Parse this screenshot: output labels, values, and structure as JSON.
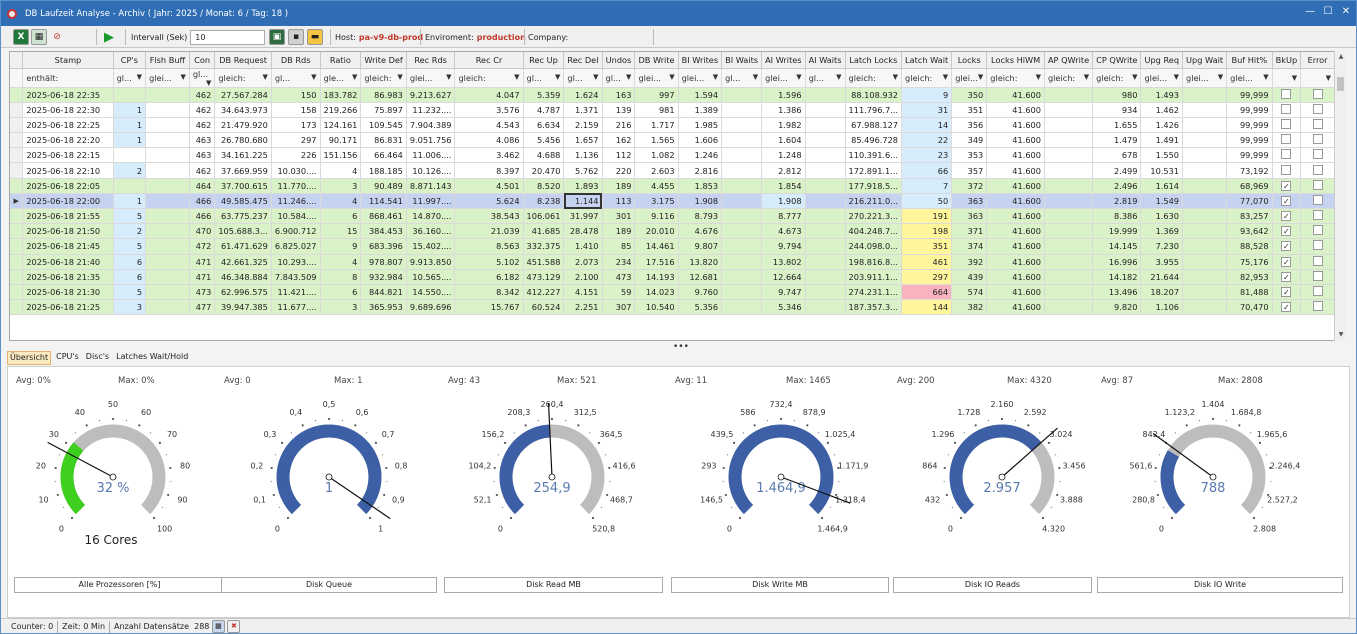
{
  "title": "DB Laufzeit Analyse - Archiv ( Jahr: 2025 / Monat: 6  / Tag: 18 )",
  "toolbar": {
    "interval_label": "Intervall (Sek)",
    "interval_value": "10",
    "host_label": "Host:",
    "host_value": "pa-v9-db-prod",
    "env_label": "Enviroment:",
    "env_value": "production",
    "company_label": "Company:",
    "company_value": ""
  },
  "grid": {
    "columns": [
      "Stamp",
      "CP's",
      "Flsh Buff",
      "Con",
      "DB Request",
      "DB Rds",
      "Ratio",
      "Write Def",
      "Rec Rds",
      "Rec Cr",
      "Rec Up",
      "Rec Del",
      "Undos",
      "DB Write",
      "BI Writes",
      "BI Waits",
      "AI Writes",
      "AI Waits",
      "Latch Locks",
      "Latch Wait",
      "Locks",
      "Locks HiWM",
      "AP QWrite",
      "CP QWrite",
      "Upg Req",
      "Upg Wait",
      "Buf Hit%",
      "BkUp",
      "Error"
    ],
    "filters": [
      "enthält:",
      "gl...",
      "glei...",
      "gl...",
      "gleich:",
      "gl...",
      "gle...",
      "gleich:",
      "glei...",
      "gleich:",
      "gl...",
      "gl...",
      "gl...",
      "glei...",
      "glei...",
      "gl...",
      "glei...",
      "gl...",
      "gleich:",
      "gleich:",
      "glei...",
      "gleich:",
      "gleich:",
      "gleich:",
      "glei...",
      "glei...",
      "glei...",
      "",
      ""
    ],
    "rows": [
      {
        "s": "green",
        "cells": [
          "2025-06-18 22:35",
          "",
          "",
          "462",
          "27.567.284",
          "150",
          "183.782",
          "86.983",
          "9.213.627",
          "4.047",
          "5.359",
          "1.624",
          "163",
          "997",
          "1.594",
          "",
          "1.596",
          "",
          "88.108.932",
          "9",
          "350",
          "41.600",
          "",
          "980",
          "1.493",
          "",
          "99,999",
          "",
          ""
        ]
      },
      {
        "s": "",
        "cells": [
          "2025-06-18 22:30",
          "1",
          "",
          "462",
          "34.643.973",
          "158",
          "219.266",
          "75.897",
          "11.232....",
          "3.576",
          "4.787",
          "1.371",
          "139",
          "981",
          "1.389",
          "",
          "1.386",
          "",
          "111.796.7...",
          "31",
          "351",
          "41.600",
          "",
          "934",
          "1.462",
          "",
          "99,999",
          "",
          ""
        ]
      },
      {
        "s": "",
        "cells": [
          "2025-06-18 22:25",
          "1",
          "",
          "462",
          "21.479.920",
          "173",
          "124.161",
          "109.545",
          "7.904.389",
          "4.543",
          "6.634",
          "2.159",
          "216",
          "1.717",
          "1.985",
          "",
          "1.982",
          "",
          "67.988.127",
          "14",
          "356",
          "41.600",
          "",
          "1.655",
          "1.426",
          "",
          "99,999",
          "",
          ""
        ]
      },
      {
        "s": "",
        "cells": [
          "2025-06-18 22:20",
          "1",
          "",
          "463",
          "26.780.680",
          "297",
          "90.171",
          "86.831",
          "9.051.756",
          "4.086",
          "5.456",
          "1.657",
          "162",
          "1.565",
          "1.606",
          "",
          "1.604",
          "",
          "85.496.728",
          "22",
          "349",
          "41.600",
          "",
          "1.479",
          "1.491",
          "",
          "99,999",
          "",
          ""
        ]
      },
      {
        "s": "",
        "cells": [
          "2025-06-18 22:15",
          "",
          "",
          "463",
          "34.161.225",
          "226",
          "151.156",
          "66.464",
          "11.006....",
          "3.462",
          "4.688",
          "1.136",
          "112",
          "1.082",
          "1.246",
          "",
          "1.248",
          "",
          "110.391.6...",
          "23",
          "353",
          "41.600",
          "",
          "678",
          "1.550",
          "",
          "99,999",
          "",
          ""
        ]
      },
      {
        "s": "",
        "cells": [
          "2025-06-18 22:10",
          "2",
          "",
          "462",
          "37.669.959",
          "10.030....",
          "4",
          "188.185",
          "10.126....",
          "8.397",
          "20.470",
          "5.762",
          "220",
          "2.603",
          "2.816",
          "",
          "2.812",
          "",
          "172.891.1...",
          "66",
          "357",
          "41.600",
          "",
          "2.499",
          "10.531",
          "",
          "73,192",
          "",
          ""
        ]
      },
      {
        "s": "green",
        "cells": [
          "2025-06-18 22:05",
          "",
          "",
          "464",
          "37.700.615",
          "11.770....",
          "3",
          "90.489",
          "8.871.143",
          "4.501",
          "8.520",
          "1.893",
          "189",
          "4.455",
          "1.853",
          "",
          "1.854",
          "",
          "177.918.5...",
          "7",
          "372",
          "41.600",
          "",
          "2.496",
          "1.614",
          "",
          "68,969",
          "✓",
          ""
        ]
      },
      {
        "s": "blue",
        "cells": [
          "2025-06-18 22:00",
          "1",
          "",
          "466",
          "49.585.475",
          "11.246....",
          "4",
          "114.541",
          "11.997....",
          "5.624",
          "8.238",
          "1.144",
          "113",
          "3.175",
          "1.908",
          "",
          "1.908",
          "",
          "216.211.0...",
          "50",
          "363",
          "41.600",
          "",
          "2.819",
          "1.549",
          "",
          "77,070",
          "✓",
          ""
        ]
      },
      {
        "s": "green",
        "cells": [
          "2025-06-18 21:55",
          "5",
          "",
          "466",
          "63.775.237",
          "10.584....",
          "6",
          "868.461",
          "14.870....",
          "38.543",
          "106.061",
          "31.997",
          "301",
          "9.116",
          "8.793",
          "",
          "8.777",
          "",
          "270.221.3...",
          "191",
          "363",
          "41.600",
          "",
          "8.386",
          "1.630",
          "",
          "83,257",
          "✓",
          ""
        ]
      },
      {
        "s": "green",
        "cells": [
          "2025-06-18 21:50",
          "2",
          "",
          "470",
          "105.688.3...",
          "6.900.712",
          "15",
          "384.453",
          "36.160....",
          "21.039",
          "41.685",
          "28.478",
          "189",
          "20.010",
          "4.676",
          "",
          "4.673",
          "",
          "404.248.7...",
          "198",
          "371",
          "41.600",
          "",
          "19.999",
          "1.369",
          "",
          "93,642",
          "✓",
          ""
        ]
      },
      {
        "s": "green",
        "cells": [
          "2025-06-18 21:45",
          "5",
          "",
          "472",
          "61.471.629",
          "6.825.027",
          "9",
          "683.396",
          "15.402....",
          "8.563",
          "332.375",
          "1.410",
          "85",
          "14.461",
          "9.807",
          "",
          "9.794",
          "",
          "244.098.0...",
          "351",
          "374",
          "41.600",
          "",
          "14.145",
          "7.230",
          "",
          "88,528",
          "✓",
          ""
        ]
      },
      {
        "s": "green",
        "cells": [
          "2025-06-18 21:40",
          "6",
          "",
          "471",
          "42.661.325",
          "10.293....",
          "4",
          "978.807",
          "9.913.850",
          "5.102",
          "451.588",
          "2.073",
          "234",
          "17.516",
          "13.820",
          "",
          "13.802",
          "",
          "198.816.8...",
          "461",
          "392",
          "41.600",
          "",
          "16.996",
          "3.955",
          "",
          "75,176",
          "✓",
          ""
        ]
      },
      {
        "s": "green",
        "cells": [
          "2025-06-18 21:35",
          "6",
          "",
          "471",
          "46.348.884",
          "7.843.509",
          "8",
          "932.984",
          "10.565....",
          "6.182",
          "473.129",
          "2.100",
          "473",
          "14.193",
          "12.681",
          "",
          "12.664",
          "",
          "203.911.1...",
          "297",
          "439",
          "41.600",
          "",
          "14.182",
          "21.644",
          "",
          "82,953",
          "✓",
          ""
        ]
      },
      {
        "s": "green",
        "cells": [
          "2025-06-18 21:30",
          "5",
          "",
          "473",
          "62.996.575",
          "11.421....",
          "6",
          "844.821",
          "14.550....",
          "8.342",
          "412.227",
          "4.151",
          "59",
          "14.023",
          "9.760",
          "",
          "9.747",
          "",
          "274.231.1...",
          "664",
          "574",
          "41.600",
          "",
          "13.496",
          "18.207",
          "",
          "81,488",
          "✓",
          ""
        ]
      },
      {
        "s": "green",
        "cells": [
          "2025-06-18 21:25",
          "3",
          "",
          "477",
          "39.947.385",
          "11.677....",
          "3",
          "365.953",
          "9.689.696",
          "15.767",
          "60.524",
          "2.251",
          "307",
          "10.540",
          "5.356",
          "",
          "5.346",
          "",
          "187.357.3...",
          "144",
          "382",
          "41.600",
          "",
          "9.820",
          "1.106",
          "",
          "70,470",
          "✓",
          ""
        ]
      }
    ]
  },
  "tabs": [
    "Übersicht",
    "CPU's",
    "Disc's",
    "Latches Wait/Hold"
  ],
  "gauges": [
    {
      "avg": "Avg: 0%",
      "max": "Max: 0%",
      "ticks": [
        "0",
        "10",
        "20",
        "30",
        "40",
        "50",
        "60",
        "70",
        "80",
        "90",
        "100"
      ],
      "value": "32 %",
      "extra": "16 Cores",
      "label": "Alle Prozessoren [%]",
      "frac": 0.32,
      "needle": 0.27,
      "fill": "#3ecf1f"
    },
    {
      "avg": "Avg: 0",
      "max": "Max: 1",
      "ticks": [
        "0",
        "0,1",
        "0,2",
        "0,3",
        "0,4",
        "0,5",
        "0,6",
        "0,7",
        "0,8",
        "0,9",
        "1"
      ],
      "value": "1",
      "extra": "",
      "label": "Disk Queue",
      "frac": 1.0,
      "needle": 0.96,
      "fill": "#3c5fa5"
    },
    {
      "avg": "Avg: 43",
      "max": "Max: 521",
      "ticks": [
        "0",
        "52,1",
        "104,2",
        "156,2",
        "208,3",
        "260,4",
        "312,5",
        "364,5",
        "416,6",
        "468,7",
        "520,8"
      ],
      "value": "254,9",
      "extra": "",
      "label": "Disk Read MB",
      "frac": 0.49,
      "needle": 0.49,
      "fill": "#3c5fa5"
    },
    {
      "avg": "Avg: 11",
      "max": "Max: 1465",
      "ticks": [
        "0",
        "146,5",
        "293",
        "439,5",
        "586",
        "732,4",
        "878,9",
        "1.025,4",
        "1.171,9",
        "1.318,4",
        "1.464,9"
      ],
      "value": "1.464,9",
      "extra": "",
      "label": "Disk Write MB",
      "frac": 1.0,
      "needle": 0.91,
      "fill": "#3c5fa5"
    },
    {
      "avg": "Avg: 200",
      "max": "Max: 4320",
      "ticks": [
        "0",
        "432",
        "864",
        "1.296",
        "1.728",
        "2.160",
        "2.592",
        "3.024",
        "3.456",
        "3.888",
        "4.320"
      ],
      "value": "2.957",
      "extra": "",
      "label": "Disk IO Reads",
      "frac": 0.68,
      "needle": 0.68,
      "fill": "#3c5fa5"
    },
    {
      "avg": "Avg: 87",
      "max": "Max: 2808",
      "ticks": [
        "0",
        "280,8",
        "561,6",
        "842,4",
        "1.123,2",
        "1.404",
        "1.684,8",
        "1.965,6",
        "2.246,4",
        "2.527,2",
        "2.808"
      ],
      "value": "788",
      "extra": "",
      "label": "Disk IO Write",
      "frac": 0.28,
      "needle": 0.3,
      "fill": "#3c5fa5"
    }
  ],
  "status": {
    "counter_label": "Counter:",
    "counter_value": "0",
    "time_label": "Zeit:",
    "time_value": "0 Min",
    "records_label": "Anzahl Datensätze",
    "records_value": "288"
  }
}
